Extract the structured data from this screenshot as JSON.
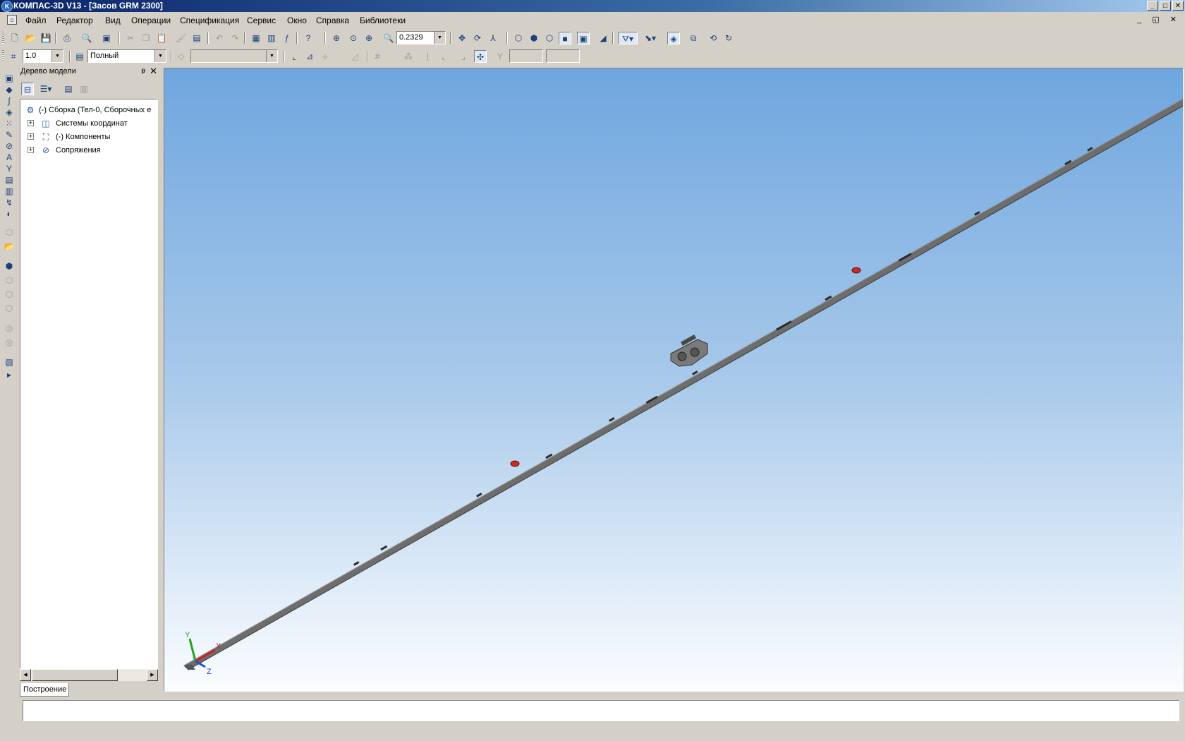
{
  "window": {
    "title": "КОМПАС-3D V13 - [Засов GRM 2300]",
    "app_icon": "kompas-logo-icon",
    "buttons": {
      "minimize": "_",
      "maximize": "□",
      "close": "✕"
    }
  },
  "menu": {
    "items": [
      "Файл",
      "Редактор",
      "Вид",
      "Операции",
      "Спецификация",
      "Сервис",
      "Окно",
      "Справка",
      "Библиотеки"
    ],
    "mdi_buttons": "_ ◱ ✕"
  },
  "toolbar1": {
    "zoom_value": "0.2329"
  },
  "toolbar2": {
    "step_value": "1.0",
    "mode_value": "Полный",
    "layer_value": ""
  },
  "tree": {
    "header": "Дерево модели",
    "pin": "ᵽ",
    "close": "✕",
    "tab_label": "Построение",
    "nodes": [
      {
        "label": "(-) Сборка (Тел-0, Сборочных е",
        "icon": "assembly-icon",
        "expandable": false
      },
      {
        "label": "Системы координат",
        "icon": "coordinate-systems-icon",
        "expandable": true
      },
      {
        "label": "(-) Компоненты",
        "icon": "components-icon",
        "expandable": true
      },
      {
        "label": "Сопряжения",
        "icon": "mates-icon",
        "expandable": true
      }
    ]
  },
  "viewport": {
    "background_top": "#6fa6df",
    "background_bottom": "#fbfdff",
    "axis_labels": {
      "x": "X",
      "y": "Y",
      "z": "Z"
    },
    "axis_colors": {
      "x": "#d21f1f",
      "y": "#1fa51f",
      "z": "#1f4fd2"
    }
  },
  "status": {
    "text": ""
  },
  "colors": {
    "chrome": "#d4d0c8",
    "title_start": "#0a246a",
    "title_end": "#a6caf0",
    "icon_blue": "#1d3f7a",
    "bar_body": "#6d6d6d",
    "mark_red": "#c92b1f"
  }
}
